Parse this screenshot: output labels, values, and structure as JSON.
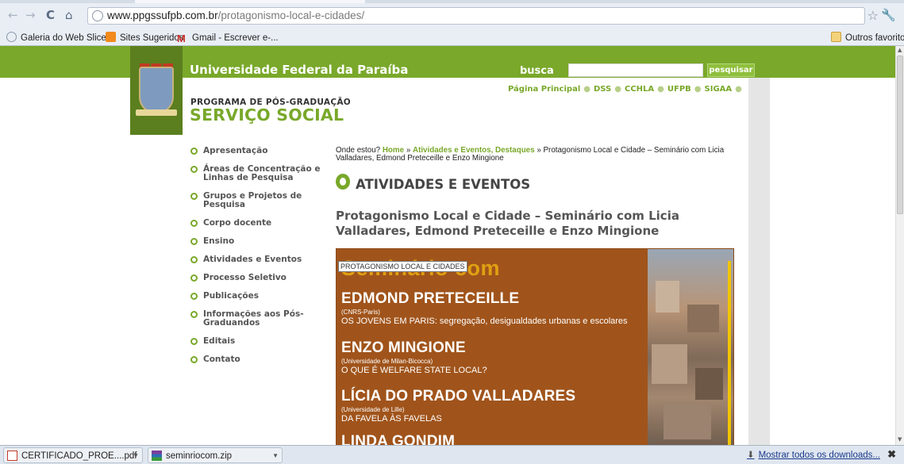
{
  "browser": {
    "url_host": "www.ppgssufpb.com.br",
    "url_path": "/protagonismo-local-e-cidades/",
    "bookmarks": [
      "Galeria do Web Slice",
      "Sites Sugeridos",
      "Gmail - Escrever e-...",
      "Outros favoritos"
    ]
  },
  "header": {
    "university": "Universidade Federal da Paraíba",
    "busca_label": "busca",
    "search_button": "pesquisar",
    "topnav": [
      "Página Principal",
      "DSS",
      "CCHLA",
      "UFPB",
      "SIGAA"
    ],
    "programa": "PROGRAMA DE PÓS-GRADUAÇÃO",
    "servico": "SERVIÇO SOCIAL"
  },
  "sidebar": {
    "items": [
      "Apresentação",
      "Áreas de Concentração e Linhas de Pesquisa",
      "Grupos e Projetos de Pesquisa",
      "Corpo docente",
      "Ensino",
      "Atividades e Eventos",
      "Processo Seletivo",
      "Publicações",
      "Informações aos Pós-Graduandos",
      "Editais",
      "Contato"
    ]
  },
  "breadcrumb": {
    "prefix": "Onde estou?",
    "home": "Home",
    "sep": "»",
    "cat1": "Atividades e Eventos",
    "comma": ",",
    "cat2": "Destaques",
    "current": "Protagonismo Local e Cidade – Seminário com Licia Valladares, Edmond Preteceille e Enzo Mingione"
  },
  "section_title": "ATIVIDADES E EVENTOS",
  "post_title": "Protagonismo Local e Cidade – Seminário com Licia Valladares, Edmond Preteceille e Enzo Mingione",
  "poster": {
    "headline": "Seminário com",
    "tooltip": "PROTAGONISMO LOCAL E CIDADES",
    "speakers": [
      {
        "name": "EDMOND PRETECEILLE",
        "inst": "(CNRS-Paris)",
        "topic": "OS JOVENS EM PARIS: segregação, desigualdades urbanas e escolares"
      },
      {
        "name": "ENZO MINGIONE",
        "inst": "(Universidade de Milan-Bicocca)",
        "topic": "O QUE É WELFARE STATE LOCAL?"
      },
      {
        "name": "LÍCIA DO PRADO VALLADARES",
        "inst": "(Universidade de Lille)",
        "topic": "DA FAVELA ÀS FAVELAS"
      },
      {
        "name": "LINDA GONDIM",
        "inst": "",
        "topic": ""
      }
    ]
  },
  "downloads": {
    "items": [
      "CERTIFICADO_PROE....pdf",
      "seminriocom.zip"
    ],
    "show_all": "Mostrar todos os downloads...",
    "close": "✖"
  }
}
